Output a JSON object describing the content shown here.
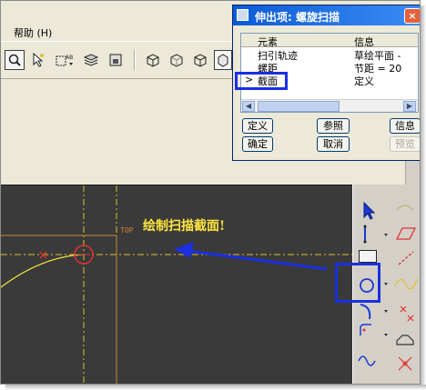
{
  "menubar": {
    "help": "帮助 (H)"
  },
  "dialog": {
    "title": "伸出项: 螺旋扫描",
    "columns": {
      "element": "元素",
      "info": "信息"
    },
    "rows": [
      {
        "element": "扫引轨迹",
        "info": "草绘平面 -"
      },
      {
        "element": "螺距",
        "info": "节距 = 20"
      },
      {
        "element": "截面",
        "info": "定义",
        "marker": ">"
      }
    ],
    "buttons": {
      "define": "定义",
      "reference": "参照",
      "info": "信息",
      "ok": "确定",
      "cancel": "取消",
      "preview": "预览"
    },
    "close": "×"
  },
  "canvas": {
    "top_label": "TOP",
    "annotation": "绘制扫描截面!"
  },
  "colors": {
    "highlight": "#1a2fe0",
    "annotation": "#ffe640",
    "canvas_bg": "#3a3a3a",
    "datum": "#e0c030"
  }
}
